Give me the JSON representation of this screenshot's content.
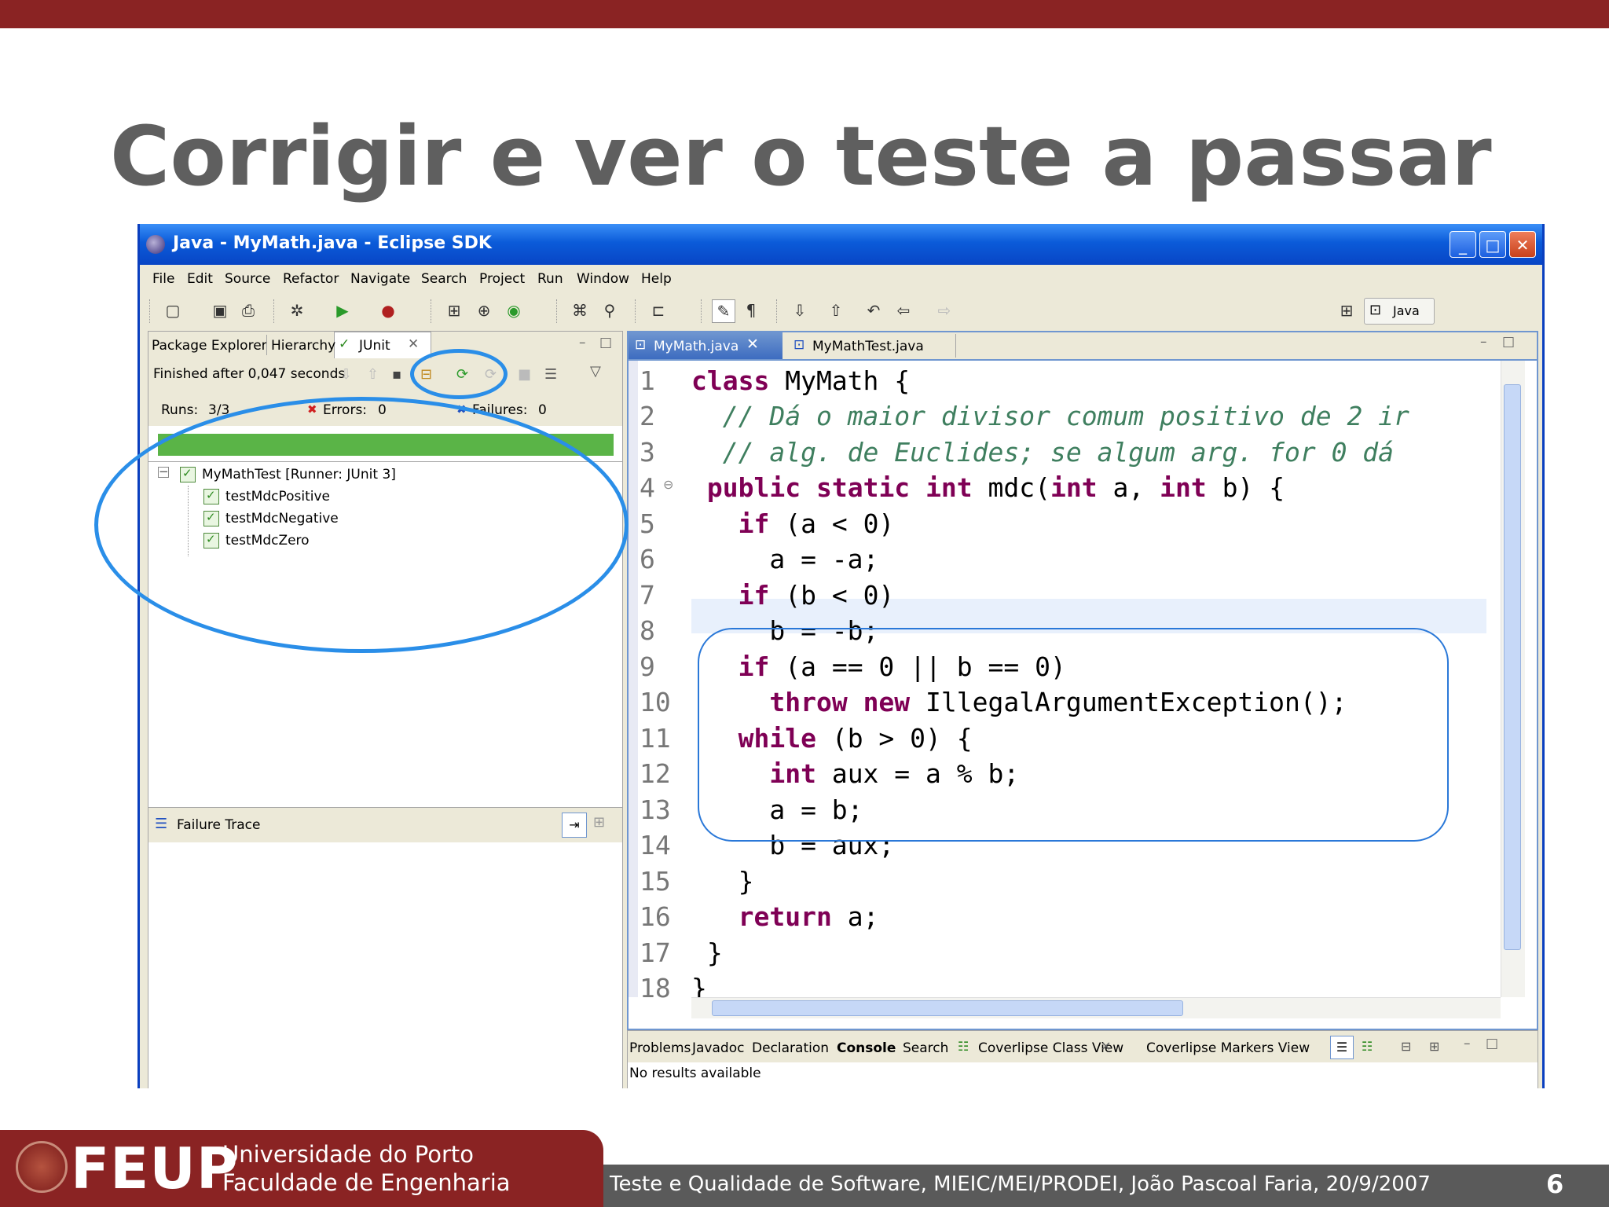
{
  "slide": {
    "title": "Corrigir e ver o teste a passar",
    "page_number": "6",
    "footer_text": "Teste e Qualidade de Software, MIEIC/MEI/PRODEI, João Pascoal Faria, 20/9/2007",
    "logo": {
      "name": "FEUP",
      "line1": "Universidade do Porto",
      "line2": "Faculdade de Engenharia"
    },
    "colors": {
      "brand": "#8a2323",
      "title": "#5f5f5f",
      "annotation": "#2a8ee8",
      "junit_green": "#5ab447"
    }
  },
  "window": {
    "title": "Java - MyMath.java - Eclipse SDK",
    "menu": [
      "File",
      "Edit",
      "Source",
      "Refactor",
      "Navigate",
      "Search",
      "Project",
      "Run",
      "Window",
      "Help"
    ],
    "perspective": "Java"
  },
  "left_panel": {
    "tabs": [
      "Package Explorer",
      "Hierarchy",
      "JUnit"
    ],
    "status": "Finished after 0,047 seconds",
    "runs_label": "Runs:",
    "runs_value": "3/3",
    "errors_label": "Errors:",
    "errors_value": "0",
    "failures_label": "Failures:",
    "failures_value": "0",
    "progress": 1.0,
    "tree": {
      "root": "MyMathTest [Runner: JUnit 3]",
      "children": [
        "testMdcPositive",
        "testMdcNegative",
        "testMdcZero"
      ]
    },
    "failure_trace_label": "Failure Trace"
  },
  "editor": {
    "tabs": [
      "MyMath.java",
      "MyMathTest.java"
    ],
    "line_numbers": [
      "1",
      "2",
      "3",
      "4",
      "5",
      "6",
      "7",
      "8",
      "9",
      "10",
      "11",
      "12",
      "13",
      "14",
      "15",
      "16",
      "17",
      "18"
    ],
    "code": {
      "l1_kw": "class",
      "l1_rest": " MyMath {",
      "l2": "  // Dá o maior divisor comum positivo de 2 ir",
      "l3": "  // alg. de Euclides; se algum arg. for 0 dá",
      "l4_a": "public",
      "l4_b": "static",
      "l4_c": "int",
      "l4_d": " mdc(",
      "l4_e": "int",
      "l4_f": " a, ",
      "l4_g": "int",
      "l4_h": " b) {",
      "l5_kw": "if",
      "l5_rest": " (a < 0)",
      "l6": "     a = -a;",
      "l7_kw": "if",
      "l7_rest": " (b < 0)",
      "l8": "     b = -b;",
      "l9_kw": "if",
      "l9_rest": " (a == 0 || b == 0)",
      "l10_a": "throw",
      "l10_b": "new",
      "l10_c": " IllegalArgumentException();",
      "l11_kw": "while",
      "l11_rest": " (b > 0) {",
      "l12_kw": "int",
      "l12_rest": " aux = a % b;",
      "l13": "     a = b;",
      "l14": "     b = aux;",
      "l15": "   }",
      "l16_kw": "return",
      "l16_rest": " a;",
      "l17": " }",
      "l18": "}"
    }
  },
  "bottom_panel": {
    "tabs": [
      "Problems",
      "Javadoc",
      "Declaration",
      "Console",
      "Search",
      "Coverlipse Class View",
      "Coverlipse Markers View"
    ],
    "content": "No results available"
  }
}
